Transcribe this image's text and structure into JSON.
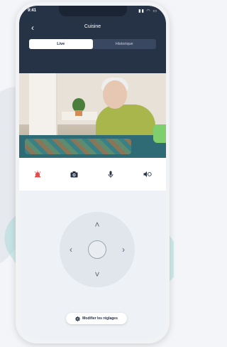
{
  "status": {
    "time": "9:41",
    "icons": "▮▮ ◠ ▭"
  },
  "header": {
    "back_icon": "chevron-left-icon",
    "title": "Cuisine"
  },
  "tabs": [
    {
      "label": "Live",
      "active": true
    },
    {
      "label": "Historique",
      "active": false
    }
  ],
  "actions": [
    {
      "icon": "alarm-icon",
      "color": "#e84c4c"
    },
    {
      "icon": "camera-icon",
      "color": "#263246"
    },
    {
      "icon": "microphone-icon",
      "color": "#263246"
    },
    {
      "icon": "speaker-icon",
      "color": "#263246"
    }
  ],
  "dpad": {
    "up": "˄",
    "down": "˅",
    "left": "‹",
    "right": "›"
  },
  "manage_button": {
    "icon": "gear-icon",
    "label": "Modifier les réglages"
  },
  "colors": {
    "header_bg": "#263246",
    "screen_bg": "#eef1f5",
    "alarm": "#e84c4c"
  }
}
